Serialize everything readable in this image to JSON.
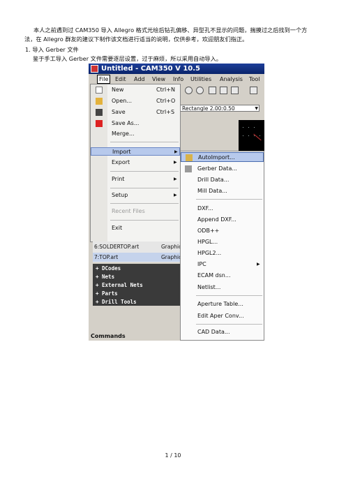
{
  "document": {
    "para1_line1": "本人之前遇到过 CAM350 导入 Allegro 格式光绘后钻孔偏移、异型孔不显示的问题，揣摸过之后找到一个方",
    "para1_line2": "法，在 Allegro 群友的建议下制作该文档进行适当的说明，仅供参考，欢迎朋友们指正。",
    "step1": "1.   导入 Gerber 文件",
    "step1_desc": "鉴于手工导入 Gerber 文件需要逐层设置，过于麻烦，所以采用自动导入。",
    "page_number": "1 / 10"
  },
  "screenshot": {
    "window_title": "Untitled - CAM350 V 10.5",
    "menubar": [
      "File",
      "Edit",
      "Add",
      "View",
      "Info",
      "Utilities",
      "Analysis",
      "Tool"
    ],
    "combo_value": "Rectangle 2.00:0.50",
    "file_menu": {
      "new": "New",
      "new_shortcut": "Ctrl+N",
      "open": "Open...",
      "open_shortcut": "Ctrl+O",
      "save": "Save",
      "save_shortcut": "Ctrl+S",
      "save_as": "Save As...",
      "merge": "Merge...",
      "import": "Import",
      "export": "Export",
      "print": "Print",
      "setup": "Setup",
      "recent_files": "Recent Files",
      "exit": "Exit"
    },
    "recent_files": [
      {
        "name": "6:SOLDERTOP.art",
        "type": "Graphic"
      },
      {
        "name": "7:TOP.art",
        "type": "Graphic"
      }
    ],
    "tree_items": [
      "+ DCodes",
      "+ Nets",
      "+ External Nets",
      "+ Parts",
      "+ Drill Tools"
    ],
    "commands_label": "Commands",
    "import_submenu": {
      "autoimport": "AutoImport...",
      "gerber": "Gerber Data...",
      "drill": "Drill Data...",
      "mill": "Mill Data...",
      "dxf": "DXF...",
      "append_dxf": "Append DXF...",
      "odb": "ODB++",
      "hpgl": "HPGL...",
      "hpgl2": "HPGL2...",
      "ipc": "IPC",
      "ecam": "ECAM dsn...",
      "netlist": "Netlist...",
      "aperture_table": "Aperture Table...",
      "edit_aper_conv": "Edit Aper Conv...",
      "cad_data": "CAD Data..."
    },
    "colors": {
      "title_bar": "#0a246a",
      "highlight": "#b7c9ec",
      "canvas": "#000000"
    }
  }
}
